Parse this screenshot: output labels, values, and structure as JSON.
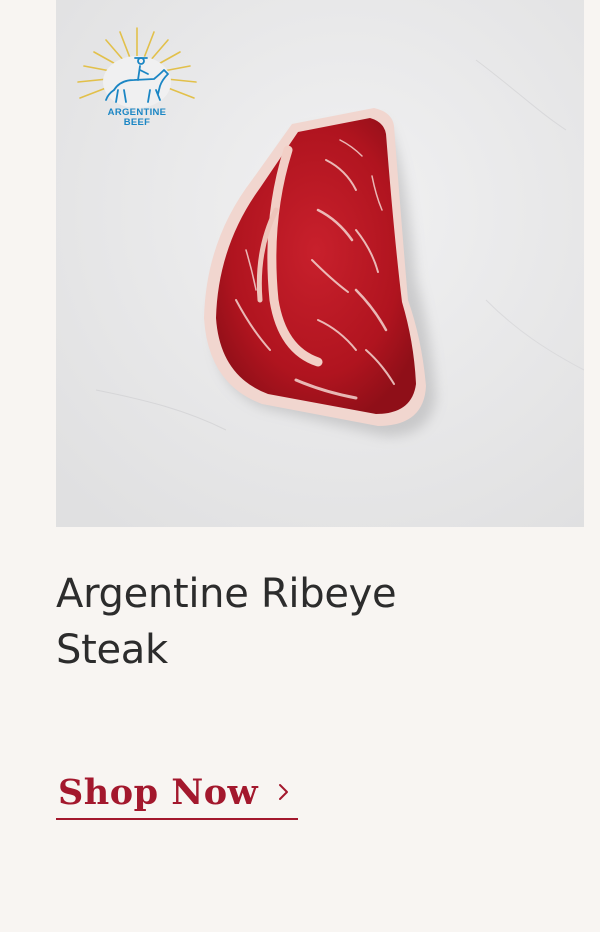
{
  "product": {
    "title": "Argentine Ribeye Steak",
    "badge": {
      "line1": "ARGENTINE",
      "line2": "BEEF",
      "icon": "gaucho-horse-sun-icon"
    },
    "image_icon": "ribeye-steak-photo"
  },
  "cta": {
    "label": "Shop Now",
    "icon": "chevron-right-icon"
  },
  "colors": {
    "background": "#f8f5f2",
    "accent": "#a3182d",
    "title": "#2c2c2c",
    "badge_blue": "#1b86c4",
    "badge_gold": "#e2c04a"
  }
}
